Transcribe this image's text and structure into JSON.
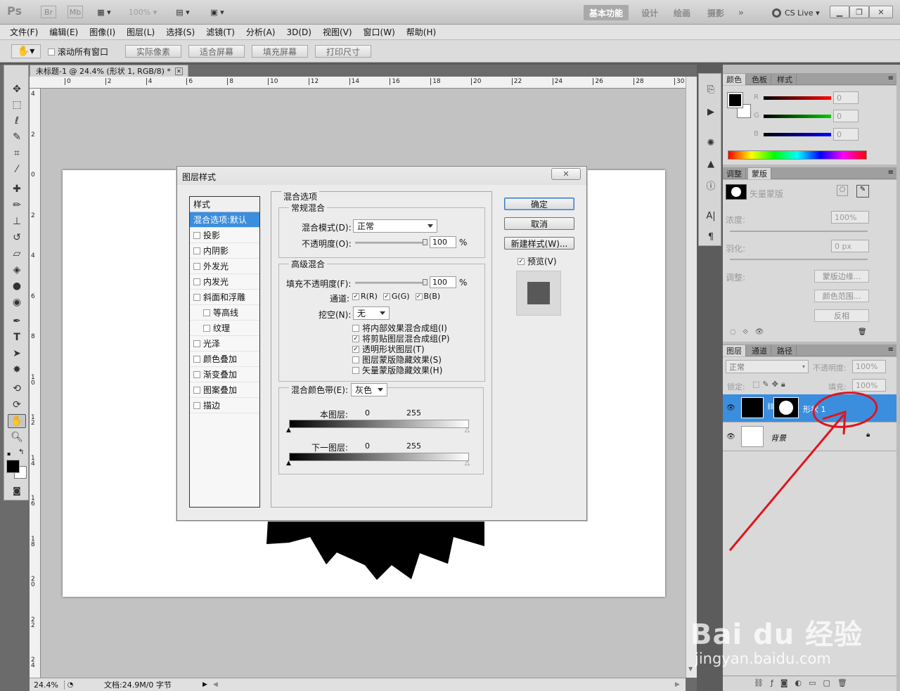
{
  "app": {
    "logo": "Ps",
    "toolbar_icons": [
      "bridge-icon",
      "minibridge-icon",
      "frame-icon",
      "zoom-icon",
      "arrange-icon",
      "screen-mode-icon"
    ],
    "zoom_display": "100%",
    "workspaces": [
      "基本功能",
      "设计",
      "绘画",
      "摄影"
    ],
    "active_workspace": "基本功能",
    "cs_live": "CS Live"
  },
  "menu": [
    "文件(F)",
    "编辑(E)",
    "图像(I)",
    "图层(L)",
    "选择(S)",
    "滤镜(T)",
    "分析(A)",
    "3D(D)",
    "视图(V)",
    "窗口(W)",
    "帮助(H)"
  ],
  "options_bar": {
    "scroll_all": "滚动所有窗口",
    "buttons": [
      "实际像素",
      "适合屏幕",
      "填充屏幕",
      "打印尺寸"
    ]
  },
  "document": {
    "tab_title": "未标题-1 @ 24.4% (形状 1, RGB/8) *",
    "ruler_top": [
      "0",
      "2",
      "4",
      "6",
      "8",
      "10",
      "12",
      "14",
      "16",
      "18",
      "20",
      "22",
      "24",
      "26",
      "28",
      "30"
    ],
    "ruler_left": [
      "4",
      "2",
      "0",
      "2",
      "4",
      "6",
      "8",
      "1\n0",
      "1\n2",
      "1\n4",
      "1\n6",
      "1\n8",
      "2\n0",
      "2\n2",
      "2\n4"
    ],
    "zoom": "24.4%",
    "status": "文档:24.9M/0 字节"
  },
  "dialog": {
    "title": "图层样式",
    "style_header": "样式",
    "styles": [
      {
        "label": "混合选项:默认",
        "selected": true,
        "checkbox": false,
        "indent": false
      },
      {
        "label": "投影",
        "checkbox": true,
        "indent": false
      },
      {
        "label": "内阴影",
        "checkbox": true,
        "indent": false
      },
      {
        "label": "外发光",
        "checkbox": true,
        "indent": false
      },
      {
        "label": "内发光",
        "checkbox": true,
        "indent": false
      },
      {
        "label": "斜面和浮雕",
        "checkbox": true,
        "indent": false
      },
      {
        "label": "等高线",
        "checkbox": true,
        "indent": true
      },
      {
        "label": "纹理",
        "checkbox": true,
        "indent": true
      },
      {
        "label": "光泽",
        "checkbox": true,
        "indent": false
      },
      {
        "label": "颜色叠加",
        "checkbox": true,
        "indent": false
      },
      {
        "label": "渐变叠加",
        "checkbox": true,
        "indent": false
      },
      {
        "label": "图案叠加",
        "checkbox": true,
        "indent": false
      },
      {
        "label": "描边",
        "checkbox": true,
        "indent": false
      }
    ],
    "blend_options_title": "混合选项",
    "general": {
      "title": "常规混合",
      "mode_label": "混合模式(D):",
      "mode_value": "正常",
      "opacity_label": "不透明度(O):",
      "opacity_value": "100",
      "opacity_unit": "%",
      "opacity_level": 1.0
    },
    "advanced": {
      "title": "高级混合",
      "fill_label": "填充不透明度(F):",
      "fill_value": "100",
      "fill_unit": "%",
      "fill_level": 1.0,
      "channels_label": "通道:",
      "channels": [
        {
          "label": "R(R)",
          "checked": true
        },
        {
          "label": "G(G)",
          "checked": true
        },
        {
          "label": "B(B)",
          "checked": true
        }
      ],
      "knockout_label": "挖空(N):",
      "knockout_value": "无",
      "options": [
        {
          "label": "将内部效果混合成组(I)",
          "checked": false
        },
        {
          "label": "将剪贴图层混合成组(P)",
          "checked": true
        },
        {
          "label": "透明形状图层(T)",
          "checked": true
        },
        {
          "label": "图层蒙版隐藏效果(S)",
          "checked": false
        },
        {
          "label": "矢量蒙版隐藏效果(H)",
          "checked": false
        }
      ]
    },
    "blend_if": {
      "label": "混合颜色带(E):",
      "value": "灰色",
      "this_layer": "本图层:",
      "underlying": "下一图层:",
      "min": "0",
      "max": "255"
    },
    "buttons": {
      "ok": "确定",
      "cancel": "取消",
      "new_style": "新建样式(W)...",
      "preview": "预览(V)",
      "preview_checked": true
    }
  },
  "panels": {
    "color_tabs": [
      "颜色",
      "色板",
      "样式"
    ],
    "color_channels": [
      {
        "label": "R",
        "value": "0"
      },
      {
        "label": "G",
        "value": "0"
      },
      {
        "label": "B",
        "value": "0"
      }
    ],
    "mask_tabs": [
      "调整",
      "蒙版"
    ],
    "mask": {
      "vector_mask": "矢量蒙版",
      "density_label": "浓度:",
      "density_value": "100%",
      "feather_label": "羽化:",
      "feather_value": "0 px",
      "adjust_label": "调整:",
      "buttons": [
        "蒙版边缘...",
        "颜色范围...",
        "反相"
      ]
    },
    "layers_tabs": [
      "图层",
      "通道",
      "路径"
    ],
    "layers": {
      "blend_mode": "正常",
      "opacity_label": "不透明度:",
      "opacity_value": "100%",
      "lock_label": "锁定:",
      "fill_label": "填充:",
      "fill_value": "100%",
      "items": [
        {
          "name": "形状 1",
          "selected": true
        },
        {
          "name": "背景",
          "selected": false,
          "locked": true
        }
      ]
    }
  },
  "watermark": {
    "brand": "Bai du 经验",
    "url": "jingyan.baidu.com"
  },
  "colors": {
    "selection_blue": "#3b8ede",
    "annotation_red": "#e0141c"
  }
}
